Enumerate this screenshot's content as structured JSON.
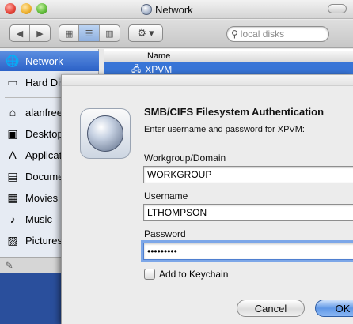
{
  "window": {
    "title": "Network"
  },
  "toolbar": {
    "back_glyph": "◀",
    "forward_glyph": "▶",
    "view_icon_glyph": "▦",
    "view_list_glyph": "☰",
    "view_column_glyph": "▥",
    "action_glyph": "⚙",
    "action_arrow": "▾",
    "search_placeholder": "local disks",
    "search_glyph": "⚲"
  },
  "sidebar": {
    "items": [
      {
        "label": "Network",
        "icon": "network-globe-icon",
        "glyph": "🌐",
        "selected": true
      },
      {
        "label": "Hard Disk",
        "icon": "hard-disk-icon",
        "glyph": "▭",
        "selected": false
      },
      {
        "label": "alanfreed",
        "icon": "home-icon",
        "glyph": "⌂",
        "selected": false
      },
      {
        "label": "Desktop",
        "icon": "desktop-icon",
        "glyph": "▣",
        "selected": false
      },
      {
        "label": "Applications",
        "icon": "applications-icon",
        "glyph": "A",
        "selected": false
      },
      {
        "label": "Documents",
        "icon": "documents-icon",
        "glyph": "▤",
        "selected": false
      },
      {
        "label": "Movies",
        "icon": "movies-icon",
        "glyph": "▦",
        "selected": false
      },
      {
        "label": "Music",
        "icon": "music-icon",
        "glyph": "♪",
        "selected": false
      },
      {
        "label": "Pictures",
        "icon": "pictures-icon",
        "glyph": "▨",
        "selected": false
      }
    ],
    "bottom_glyph": "✎"
  },
  "list": {
    "column_name": "Name",
    "rows": [
      {
        "name": "XPVM",
        "icon": "server-icon",
        "glyph": "🖧",
        "selected": true
      }
    ]
  },
  "dialog": {
    "title": "SMB/CIFS Filesystem Authentication",
    "message": "Enter username and password for XPVM:",
    "workgroup_label": "Workgroup/Domain",
    "workgroup_value": "WORKGROUP",
    "username_label": "Username",
    "username_value": "LTHOMPSON",
    "password_label": "Password",
    "password_value": "secret123",
    "keychain_label": "Add to Keychain",
    "cancel_label": "Cancel",
    "ok_label": "OK"
  },
  "colors": {
    "selection_blue": "#3875d7",
    "desktop_blue": "#2a4f9c",
    "focus_ring": "#7da7e8"
  }
}
